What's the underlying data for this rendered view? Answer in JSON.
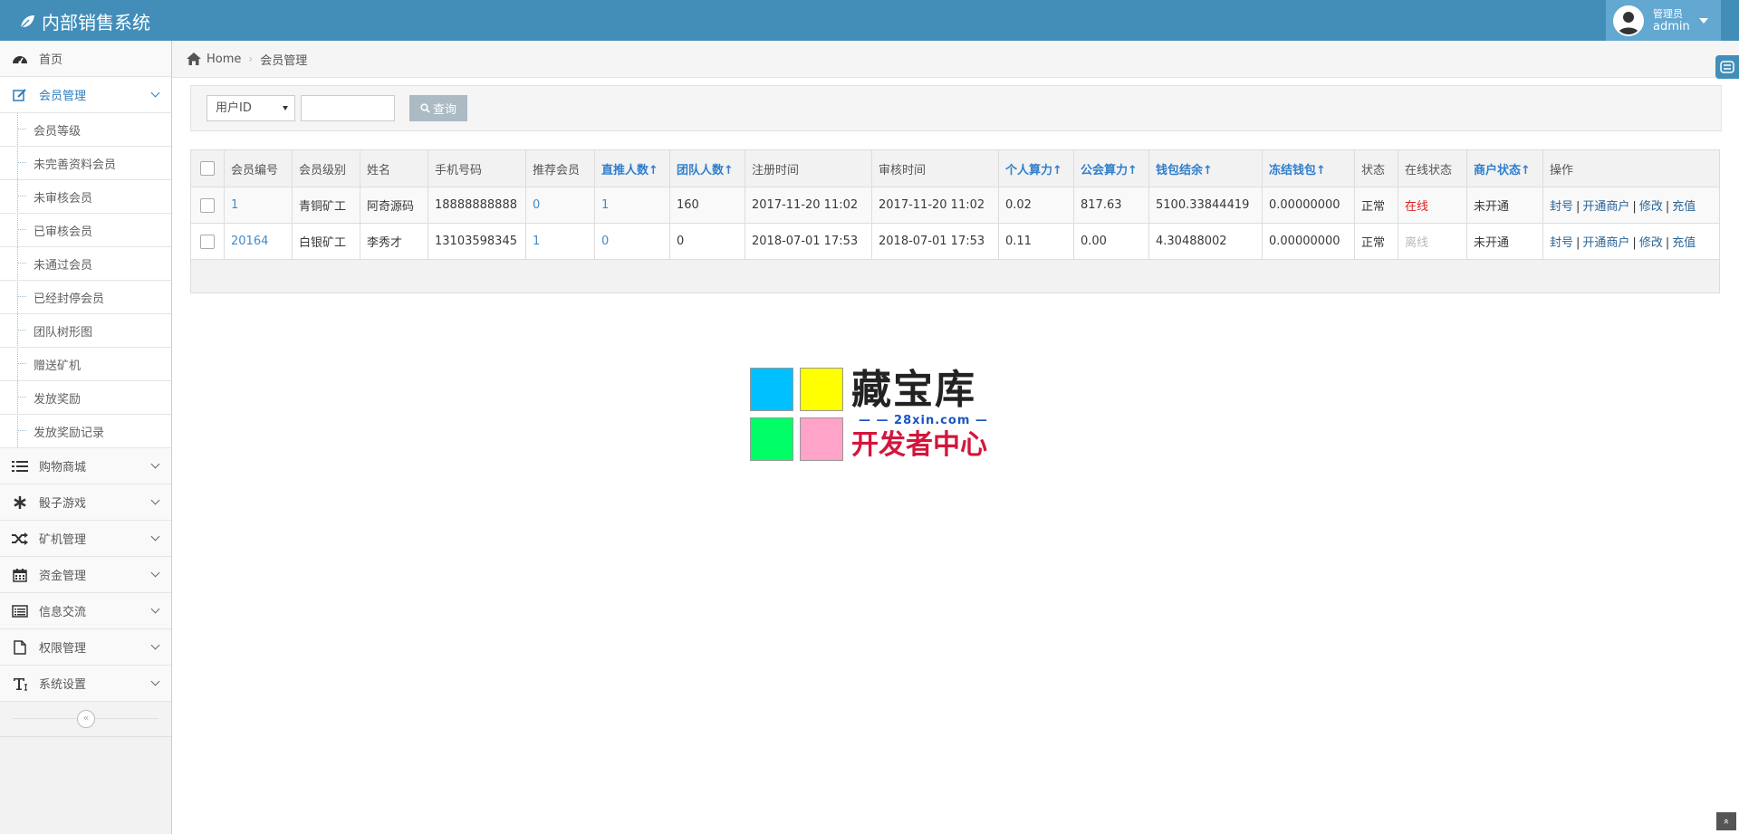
{
  "app": {
    "title": "内部销售系统"
  },
  "user": {
    "role": "管理员",
    "name": "admin"
  },
  "sidebar": {
    "items": [
      {
        "label": "首页",
        "icon": "dashboard-icon",
        "expandable": false
      },
      {
        "label": "会员管理",
        "icon": "edit-icon",
        "expandable": true,
        "active": true
      },
      {
        "label": "购物商城",
        "icon": "list-icon",
        "expandable": true
      },
      {
        "label": "骰子游戏",
        "icon": "asterisk-icon",
        "expandable": true
      },
      {
        "label": "矿机管理",
        "icon": "random-icon",
        "expandable": true
      },
      {
        "label": "资金管理",
        "icon": "calendar-icon",
        "expandable": true
      },
      {
        "label": "信息交流",
        "icon": "list-alt-icon",
        "expandable": true
      },
      {
        "label": "权限管理",
        "icon": "file-icon",
        "expandable": true
      },
      {
        "label": "系统设置",
        "icon": "text-icon",
        "expandable": true
      }
    ],
    "submenu": [
      "会员等级",
      "未完善资料会员",
      "未审核会员",
      "已审核会员",
      "未通过会员",
      "已经封停会员",
      "团队树形图",
      "赠送矿机",
      "发放奖励",
      "发放奖励记录"
    ],
    "collapse_glyph": "«"
  },
  "breadcrumb": {
    "home": "Home",
    "current": "会员管理"
  },
  "search": {
    "select_value": "用户ID",
    "input_value": "",
    "button_label": "查询"
  },
  "table": {
    "columns": [
      "会员编号",
      "会员级别",
      "姓名",
      "手机号码",
      "推荐会员",
      "直推人数↑",
      "团队人数↑",
      "注册时间",
      "审核时间",
      "个人算力↑",
      "公会算力↑",
      "钱包结余↑",
      "冻结钱包↑",
      "状态",
      "在线状态",
      "商户状态↑",
      "操作"
    ],
    "rows": [
      {
        "id": "1",
        "level": "青铜矿工",
        "name": "阿奇源码",
        "phone": "18888888888",
        "referrer": "0",
        "direct": "1",
        "team": "160",
        "reg_time": "2017-11-20 11:02",
        "audit_time": "2017-11-20 11:02",
        "personal": "0.02",
        "guild": "817.63",
        "wallet": "5100.33844419",
        "frozen": "0.00000000",
        "status": "正常",
        "online": "在线",
        "merchant": "未开通"
      },
      {
        "id": "20164",
        "level": "白银矿工",
        "name": "李秀才",
        "phone": "13103598345",
        "referrer": "1",
        "direct": "0",
        "team": "0",
        "reg_time": "2018-07-01 17:53",
        "audit_time": "2018-07-01 17:53",
        "personal": "0.11",
        "guild": "0.00",
        "wallet": "4.30488002",
        "frozen": "0.00000000",
        "status": "正常",
        "online": "离线",
        "merchant": "未开通"
      }
    ],
    "actions": [
      "封号",
      "开通商户",
      "修改",
      "充值"
    ]
  },
  "watermark": {
    "title": "藏宝库",
    "url": "— — 28xin.com — —",
    "subtitle": "开发者中心",
    "colors": [
      "#00bfff",
      "#ffff00",
      "#00ff66",
      "#ffa3c8"
    ]
  },
  "scroll_top_glyph": "»",
  "colors": {
    "navbar": "#438eb9",
    "user_box": "#62a8d1",
    "link": "#2a6496",
    "sort_header": "#307ecc",
    "online": "#dd2222"
  }
}
